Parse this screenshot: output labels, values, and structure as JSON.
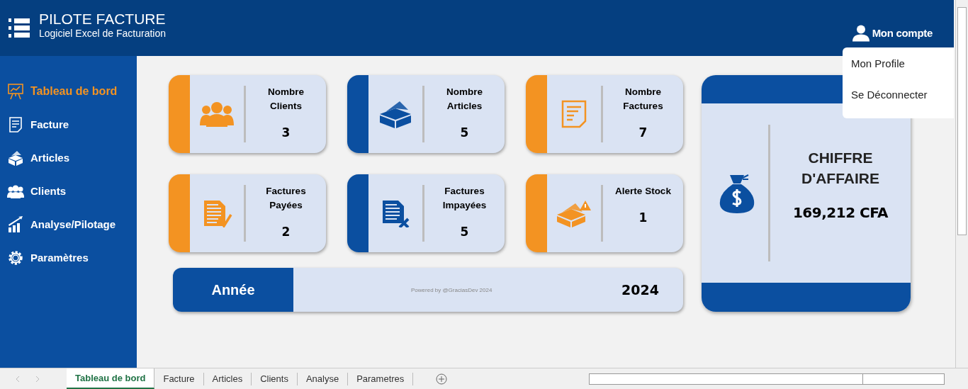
{
  "app": {
    "title": "PILOTE FACTURE",
    "subtitle": "Logiciel Excel de Facturation"
  },
  "account": {
    "label": "Mon compte",
    "menu": [
      "Mon Profile",
      "Se Déconnecter"
    ]
  },
  "sidebar": {
    "items": [
      {
        "kind": "board",
        "label": "Tableau de bord",
        "selected": true
      },
      {
        "kind": "invoice",
        "label": "Facture",
        "selected": false
      },
      {
        "kind": "box",
        "label": "Articles",
        "selected": false
      },
      {
        "kind": "people",
        "label": "Clients",
        "selected": false
      },
      {
        "kind": "chart",
        "label": "Analyse/Pilotage",
        "selected": false
      },
      {
        "kind": "gear",
        "label": "Paramètres",
        "selected": false
      }
    ]
  },
  "cards": [
    {
      "kind": "people",
      "title": "Nombre Clients",
      "value": "3",
      "color": "#f39322"
    },
    {
      "kind": "box",
      "title": "Nombre Articles",
      "value": "5",
      "color": "#0b4fa0"
    },
    {
      "kind": "invoice",
      "title": "Nombre Factures",
      "value": "7",
      "color": "#f39322"
    },
    {
      "kind": "paid",
      "title": "Factures Payées",
      "value": "2",
      "color": "#f39322"
    },
    {
      "kind": "unpaid",
      "title": "Factures Impayées",
      "value": "5",
      "color": "#0b4fa0"
    },
    {
      "kind": "alert",
      "title": "Alerte Stock",
      "value": "1",
      "color": "#f39322"
    }
  ],
  "year": {
    "label": "Année",
    "credit": "Powered by @GraciasDev 2024",
    "value": "2024"
  },
  "revenue": {
    "title": "CHIFFRE D'AFFAIRE",
    "value": "169,212 CFA"
  },
  "sheet_tabs": [
    {
      "label": "Tableau de bord",
      "selected": true
    },
    {
      "label": "Facture",
      "selected": false
    },
    {
      "label": "Articles",
      "selected": false
    },
    {
      "label": "Clients",
      "selected": false
    },
    {
      "label": "Analyse",
      "selected": false
    },
    {
      "label": "Parametres",
      "selected": false
    }
  ]
}
